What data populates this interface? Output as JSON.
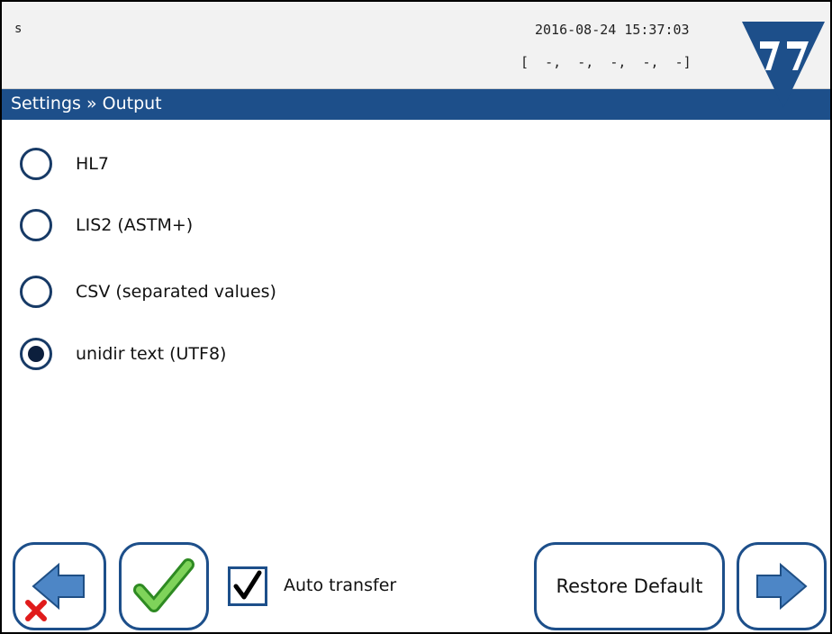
{
  "header": {
    "user": "s",
    "datetime": "2016-08-24 15:37:03",
    "status_line": "[  -,  -,  -,  -,  -]"
  },
  "breadcrumb": "Settings » Output",
  "options": [
    {
      "label": "HL7",
      "selected": false
    },
    {
      "label": "LIS2 (ASTM+)",
      "selected": false
    },
    {
      "label": "CSV (separated values)",
      "selected": false
    },
    {
      "label": "unidir text (UTF8)",
      "selected": true
    }
  ],
  "footer": {
    "auto_transfer_label": "Auto transfer",
    "auto_transfer_checked": true,
    "restore_default_label": "Restore Default"
  },
  "colors": {
    "accent": "#1d4f8a",
    "topbar": "#f2f2f2"
  },
  "icons": {
    "back": "arrow-left-icon",
    "cancel": "red-x-icon",
    "confirm": "green-check-icon",
    "next": "arrow-right-icon",
    "logo": "brand-logo"
  }
}
